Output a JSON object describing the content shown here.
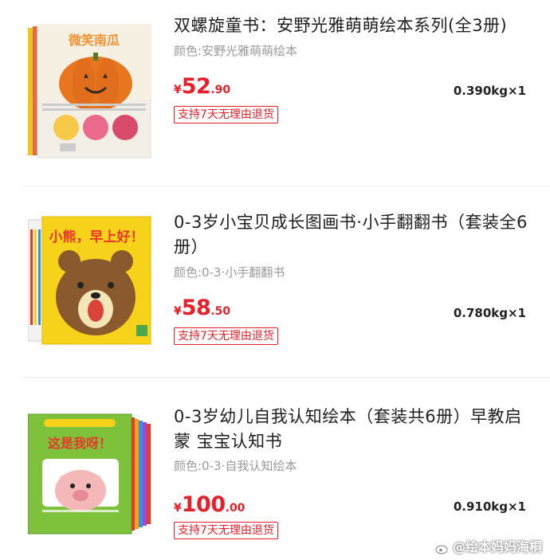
{
  "items": [
    {
      "title": "双螺旋童书：安野光雅萌萌绘本系列(全3册)",
      "variant": "颜色:安野光雅萌萌绘本",
      "price": {
        "currency": "¥",
        "integer": "52",
        "decimal": ".90"
      },
      "weight": "0.390kg×1",
      "badge": "支持7天无理由退货",
      "cover_text": "微笑南瓜",
      "cover_colors": {
        "spine": "#e8e0d0",
        "title": "#f29233",
        "pumpkin": "#e8761e"
      }
    },
    {
      "title": "0-3岁小宝贝成长图画书·小手翻翻书（套装全6册）",
      "variant": "颜色:0-3·小手翻翻书",
      "price": {
        "currency": "¥",
        "integer": "58",
        "decimal": ".50"
      },
      "weight": "0.780kg×1",
      "badge": "支持7天无理由退货",
      "cover_text": "小熊，早上好！",
      "cover_colors": {
        "bg": "#f7d21a",
        "bear": "#8a5a2e",
        "title": "#e8382a"
      }
    },
    {
      "title": "0-3岁幼儿自我认知绘本（套装共6册）早教启蒙 宝宝认知书",
      "variant": "颜色:0-3·自我认知绘本",
      "price": {
        "currency": "¥",
        "integer": "100",
        "decimal": ".00"
      },
      "weight": "0.910kg×1",
      "badge": "支持7天无理由退货",
      "cover_text": "这是我呀！",
      "cover_colors": {
        "bg": "#7ec13a",
        "pig": "#f5b8b8",
        "title": "#e8382a"
      }
    }
  ],
  "watermark": "@绘本妈妈海桐",
  "colors": {
    "accent": "#e6202a",
    "muted": "#9a9a9a"
  }
}
